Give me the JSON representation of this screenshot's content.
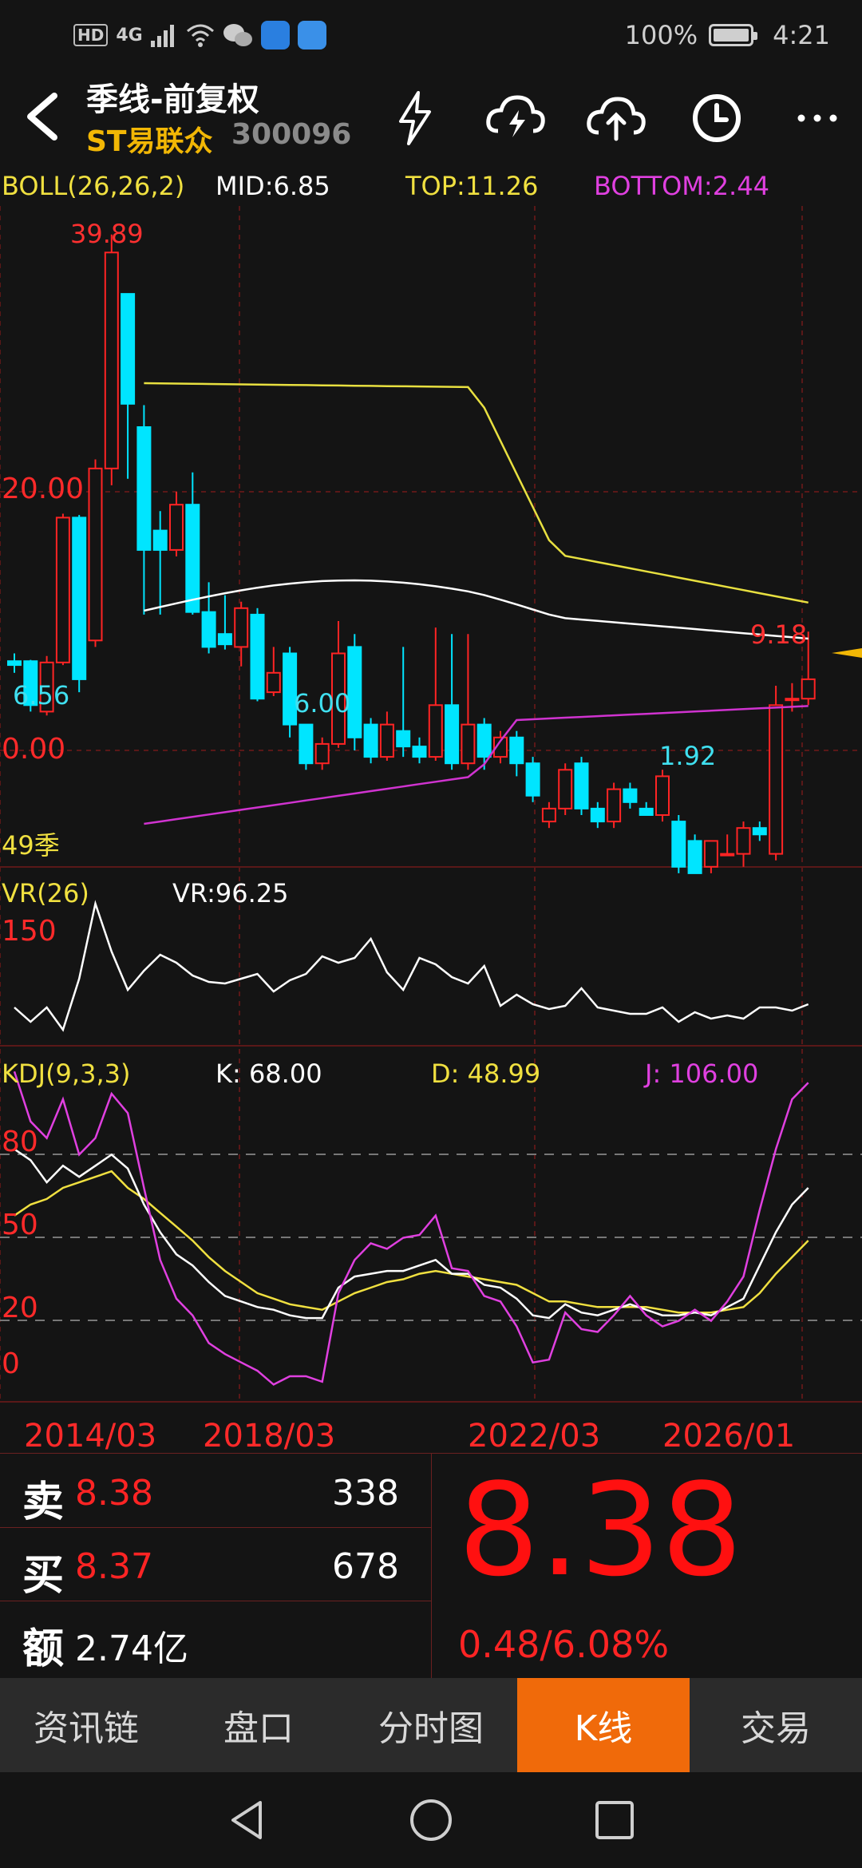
{
  "status_bar": {
    "hd": "HD",
    "network": "4G",
    "battery": "100%",
    "time": "4:21"
  },
  "header": {
    "title": "季线-前复权",
    "stock_name": "ST易联众",
    "stock_code": "300096",
    "icons": [
      "back-icon",
      "lightning-icon",
      "cloud-lightning-icon",
      "cloud-upload-icon",
      "clock-icon",
      "more-icon"
    ]
  },
  "boll": {
    "label": "BOLL(26,26,2)",
    "mid": "MID:6.85",
    "top": "TOP:11.26",
    "bottom": "BOTTOM:2.44",
    "axis_20": "20.00",
    "axis_0": "0.00",
    "period_count": "49季",
    "annotations": {
      "high": "39.89",
      "low_left": "6.56",
      "low_mid": "6.00",
      "low_right": "1.92",
      "last_high": "9.18"
    }
  },
  "vr": {
    "label": "VR(26)",
    "value": "VR:96.25",
    "axis_150": "150"
  },
  "kdj": {
    "label": "KDJ(9,3,3)",
    "k": "K: 68.00",
    "d": "D: 48.99",
    "j": "J: 106.00",
    "axis": [
      "80",
      "50",
      "20",
      "0"
    ]
  },
  "x_axis": [
    "2014/03",
    "2018/03",
    "2022/03",
    "2026/01"
  ],
  "quote": {
    "sell_key": "卖",
    "sell_price": "8.38",
    "sell_vol": "338",
    "buy_key": "买",
    "buy_price": "8.37",
    "buy_vol": "678",
    "amount_key": "额",
    "amount": "2.74亿",
    "last_price": "8.38",
    "change": "0.48/6.08%"
  },
  "tabs": [
    {
      "label": "资讯链",
      "active": false
    },
    {
      "label": "盘口",
      "active": false
    },
    {
      "label": "分时图",
      "active": false
    },
    {
      "label": "K线",
      "active": true
    },
    {
      "label": "交易",
      "active": false
    }
  ],
  "colors": {
    "up": "#ff2424",
    "down": "#00e5ff",
    "mid": "#ffffff",
    "top": "#e8e040",
    "bottom": "#d033d0",
    "accent": "#f06a0a"
  },
  "chart_data": {
    "type": "candlestick",
    "price_candles": [
      {
        "o": 6.9,
        "c": 6.6,
        "h": 7.5,
        "l": 6.0
      },
      {
        "o": 6.9,
        "c": 3.5,
        "h": 7.0,
        "l": 3.0
      },
      {
        "o": 3.0,
        "c": 6.8,
        "h": 7.3,
        "l": 2.7
      },
      {
        "o": 6.8,
        "c": 18.0,
        "h": 18.3,
        "l": 6.6
      },
      {
        "o": 18.0,
        "c": 5.5,
        "h": 18.2,
        "l": 4.5
      },
      {
        "o": 8.5,
        "c": 21.8,
        "h": 22.5,
        "l": 8.0
      },
      {
        "o": 21.8,
        "c": 38.5,
        "h": 39.89,
        "l": 20.5
      },
      {
        "o": 35.3,
        "c": 26.8,
        "h": 35.3,
        "l": 21.0
      },
      {
        "o": 25.0,
        "c": 15.5,
        "h": 26.7,
        "l": 10.5
      },
      {
        "o": 17.0,
        "c": 15.5,
        "h": 18.5,
        "l": 10.5
      },
      {
        "o": 15.5,
        "c": 19.0,
        "h": 20.0,
        "l": 15.0
      },
      {
        "o": 19.0,
        "c": 10.7,
        "h": 21.5,
        "l": 10.5
      },
      {
        "o": 10.7,
        "c": 8.0,
        "h": 13.0,
        "l": 7.5
      },
      {
        "o": 9.0,
        "c": 8.2,
        "h": 12.0,
        "l": 7.8
      },
      {
        "o": 8.0,
        "c": 11.0,
        "h": 11.5,
        "l": 6.5
      },
      {
        "o": 10.5,
        "c": 4.0,
        "h": 11.0,
        "l": 3.8
      },
      {
        "o": 4.5,
        "c": 6.0,
        "h": 8.0,
        "l": 4.2
      },
      {
        "o": 7.5,
        "c": 2.0,
        "h": 8.0,
        "l": 1.0
      },
      {
        "o": 2.0,
        "c": -1.0,
        "h": 2.0,
        "l": -1.5
      },
      {
        "o": -1.0,
        "c": 0.5,
        "h": 1.0,
        "l": -1.5
      },
      {
        "o": 0.5,
        "c": 7.5,
        "h": 10.0,
        "l": 0.2
      },
      {
        "o": 8.0,
        "c": 1.0,
        "h": 9.0,
        "l": 0.0
      },
      {
        "o": 2.0,
        "c": -0.5,
        "h": 2.5,
        "l": -1.0
      },
      {
        "o": -0.5,
        "c": 2.0,
        "h": 3.0,
        "l": -0.8
      },
      {
        "o": 1.5,
        "c": 0.3,
        "h": 8.0,
        "l": -0.5
      },
      {
        "o": 0.3,
        "c": -0.5,
        "h": 1.0,
        "l": -1.0
      },
      {
        "o": -0.5,
        "c": 3.5,
        "h": 9.5,
        "l": -0.8
      },
      {
        "o": 3.5,
        "c": -1.0,
        "h": 9.0,
        "l": -1.5
      },
      {
        "o": -1.0,
        "c": 2.0,
        "h": 9.0,
        "l": -1.5
      },
      {
        "o": 2.0,
        "c": -0.5,
        "h": 2.5,
        "l": -1.5
      },
      {
        "o": -0.5,
        "c": 1.0,
        "h": 1.5,
        "l": -1.0
      },
      {
        "o": 1.0,
        "c": -1.0,
        "h": 1.5,
        "l": -2.0
      },
      {
        "o": -1.0,
        "c": -3.5,
        "h": -0.5,
        "l": -4.0
      },
      {
        "o": -5.5,
        "c": -4.5,
        "h": -4.0,
        "l": -6.0
      },
      {
        "o": -4.5,
        "c": -1.5,
        "h": -1.0,
        "l": -5.0
      },
      {
        "o": -1.0,
        "c": -4.5,
        "h": -0.5,
        "l": -5.0
      },
      {
        "o": -4.5,
        "c": -5.5,
        "h": -4.0,
        "l": -6.0
      },
      {
        "o": -5.5,
        "c": -3.0,
        "h": -2.5,
        "l": -6.0
      },
      {
        "o": -3.0,
        "c": -4.0,
        "h": -2.5,
        "l": -4.5
      },
      {
        "o": -4.5,
        "c": -5.0,
        "h": -4.0,
        "l": -5.0
      },
      {
        "o": -5.0,
        "c": -2.0,
        "h": -1.5,
        "l": -5.5
      },
      {
        "o": -5.5,
        "c": -9.0,
        "h": -5.0,
        "l": -9.5
      },
      {
        "o": -7.0,
        "c": -9.5,
        "h": -6.5,
        "l": -9.5
      },
      {
        "o": -9.0,
        "c": -7.0,
        "h": -7.0,
        "l": -9.5
      },
      {
        "o": -8.0,
        "c": -8.0,
        "h": -6.5,
        "l": -8.0
      },
      {
        "o": -8.0,
        "c": -6.0,
        "h": -5.5,
        "l": -9.0
      },
      {
        "o": -6.0,
        "c": -6.5,
        "h": -5.5,
        "l": -7.0
      },
      {
        "o": -8.0,
        "c": 3.5,
        "h": 5.0,
        "l": -8.5
      },
      {
        "o": 4.0,
        "c": 4.0,
        "h": 5.2,
        "l": 3.0
      },
      {
        "o": 4.0,
        "c": 5.5,
        "h": 9.18,
        "l": 3.5
      }
    ],
    "boll_top": [
      null,
      null,
      null,
      null,
      null,
      null,
      null,
      null,
      null,
      null,
      null,
      null,
      null,
      null,
      null,
      null,
      null,
      null,
      null,
      null,
      null,
      null,
      null,
      null,
      null,
      null,
      null,
      null,
      null,
      null,
      null,
      null,
      null,
      null,
      null,
      null,
      null,
      null,
      null,
      null,
      null,
      null,
      null,
      null,
      null,
      null,
      null,
      null,
      null,
      null
    ],
    "kdj_k": [
      82,
      78,
      70,
      76,
      72,
      76,
      80,
      75,
      62,
      52,
      44,
      40,
      34,
      29,
      27,
      25,
      24,
      22,
      21,
      21,
      32,
      36,
      37,
      38,
      38,
      40,
      42,
      37,
      37,
      33,
      32,
      28,
      22,
      21,
      26,
      23,
      22,
      24,
      26,
      24,
      22,
      22,
      23,
      22,
      25,
      28,
      40,
      52,
      62,
      68
    ],
    "kdj_d": [
      58,
      62,
      64,
      68,
      70,
      72,
      74,
      68,
      64,
      59,
      54,
      49,
      43,
      38,
      34,
      30,
      28,
      26,
      25,
      24,
      27,
      30,
      32,
      34,
      35,
      37,
      38,
      37,
      36,
      35,
      34,
      33,
      30,
      27,
      27,
      26,
      25,
      25,
      25,
      25,
      24,
      23,
      23,
      23,
      24,
      25,
      30,
      37,
      43,
      49
    ],
    "kdj_j": [
      110,
      92,
      86,
      100,
      80,
      86,
      102,
      95,
      68,
      42,
      28,
      22,
      12,
      8,
      5,
      2,
      -3,
      0,
      0,
      -2,
      30,
      42,
      48,
      46,
      50,
      51,
      58,
      39,
      38,
      29,
      27,
      18,
      5,
      6,
      23,
      17,
      16,
      22,
      29,
      22,
      18,
      20,
      24,
      20,
      27,
      36,
      60,
      82,
      100,
      106
    ]
  }
}
